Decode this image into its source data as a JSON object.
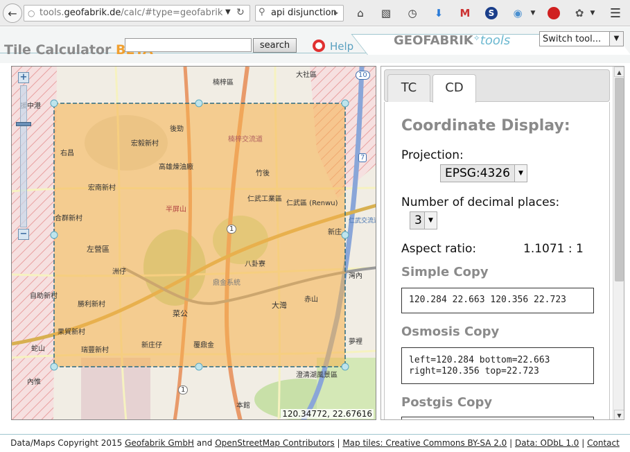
{
  "browser": {
    "url_prefix": "tools.",
    "url_domain": "geofabrik.de",
    "url_rest": "/calc/#type=geofabrik",
    "search_query": "api disjunction"
  },
  "header": {
    "title": "Tile Calculator",
    "title_beta": "BETA",
    "search_value": "",
    "search_button": "search",
    "help_label": "Help",
    "brand_main": "GEOFABRIK",
    "brand_tools": "tools",
    "switch_tool_label": "Switch tool..."
  },
  "map": {
    "coordinates_readout": "120.34772, 22.67616",
    "labels": [
      "楠梓區",
      "大社區",
      "援中港",
      "右昌",
      "宏毅新村",
      "後勁",
      "高雄煉油廠",
      "楠梓交流道",
      "竹後",
      "仁武工業區",
      "仁武區 (Renwu)",
      "宏南新村",
      "半屏山",
      "合群新村",
      "左營區",
      "八卦寮",
      "洲仔",
      "鼎金系統",
      "自助新村",
      "勝利新村",
      "菜公",
      "大灣",
      "赤山",
      "果貿新村",
      "新庄仔",
      "瑞豐新村",
      "覆鼎金",
      "內惟",
      "澄清湖風景區",
      "本館",
      "蛇山",
      "夢裡",
      "仁武交流道",
      "新庄",
      "灣內"
    ],
    "route_badges": [
      "10",
      "1",
      "1",
      "7"
    ]
  },
  "panel": {
    "tabs": [
      "TC",
      "CD"
    ],
    "active_tab": "CD",
    "heading": "Coordinate Display:",
    "projection_label": "Projection:",
    "projection_value": "EPSG:4326",
    "decimals_label": "Number of decimal places:",
    "decimals_value": "3",
    "aspect_label": "Aspect ratio:",
    "aspect_value": "1.1071 : 1",
    "simple_copy_title": "Simple Copy",
    "simple_copy_value": "120.284 22.663 120.356 22.723",
    "osmosis_copy_title": "Osmosis Copy",
    "osmosis_copy_value": "left=120.284 bottom=22.663\nright=120.356 top=22.723",
    "postgis_copy_title": "Postgis Copy",
    "postgis_copy_value": ""
  },
  "footer": {
    "text_1": "Data/Maps Copyright 2015",
    "link_geofabrik": "Geofabrik GmbH",
    "text_and": "and",
    "link_osm": "OpenStreetMap Contributors",
    "sep": "|",
    "link_tiles": "Map tiles: Creative Commons BY-SA 2.0",
    "link_odbl": "Data: ODbL 1.0",
    "link_contact": "Contact"
  },
  "colors": {
    "selection_fill": "#f5b04a",
    "selection_border": "#2a6a80",
    "accent_blue": "#5aa0c0",
    "beta_orange": "#f0a030"
  }
}
